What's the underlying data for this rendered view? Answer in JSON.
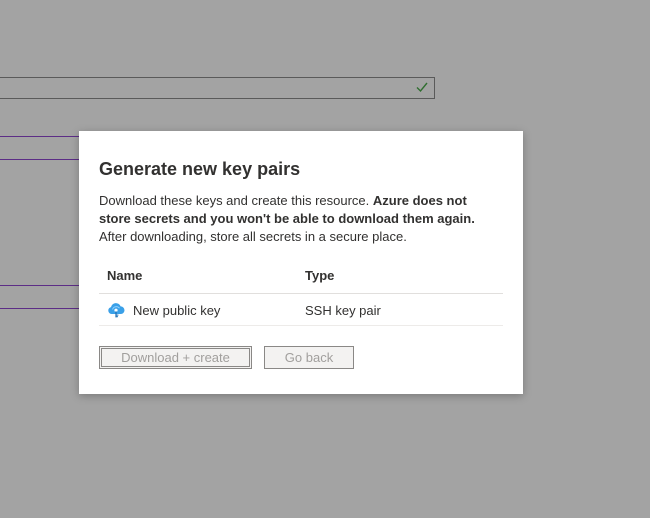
{
  "dialog": {
    "title": "Generate new key pairs",
    "description_intro": "Download these keys and create this resource. ",
    "description_bold": "Azure does not store secrets and you won't be able to download them again.",
    "description_outro": " After downloading, store all secrets in a secure place.",
    "table": {
      "headers": {
        "name": "Name",
        "type": "Type"
      },
      "rows": [
        {
          "icon": "cloud-key-icon",
          "name": "New public key",
          "type": "SSH key pair"
        }
      ]
    },
    "buttons": {
      "download_create": "Download + create",
      "go_back": "Go back"
    }
  },
  "background": {
    "field_status_icon": "checkmark-icon"
  }
}
